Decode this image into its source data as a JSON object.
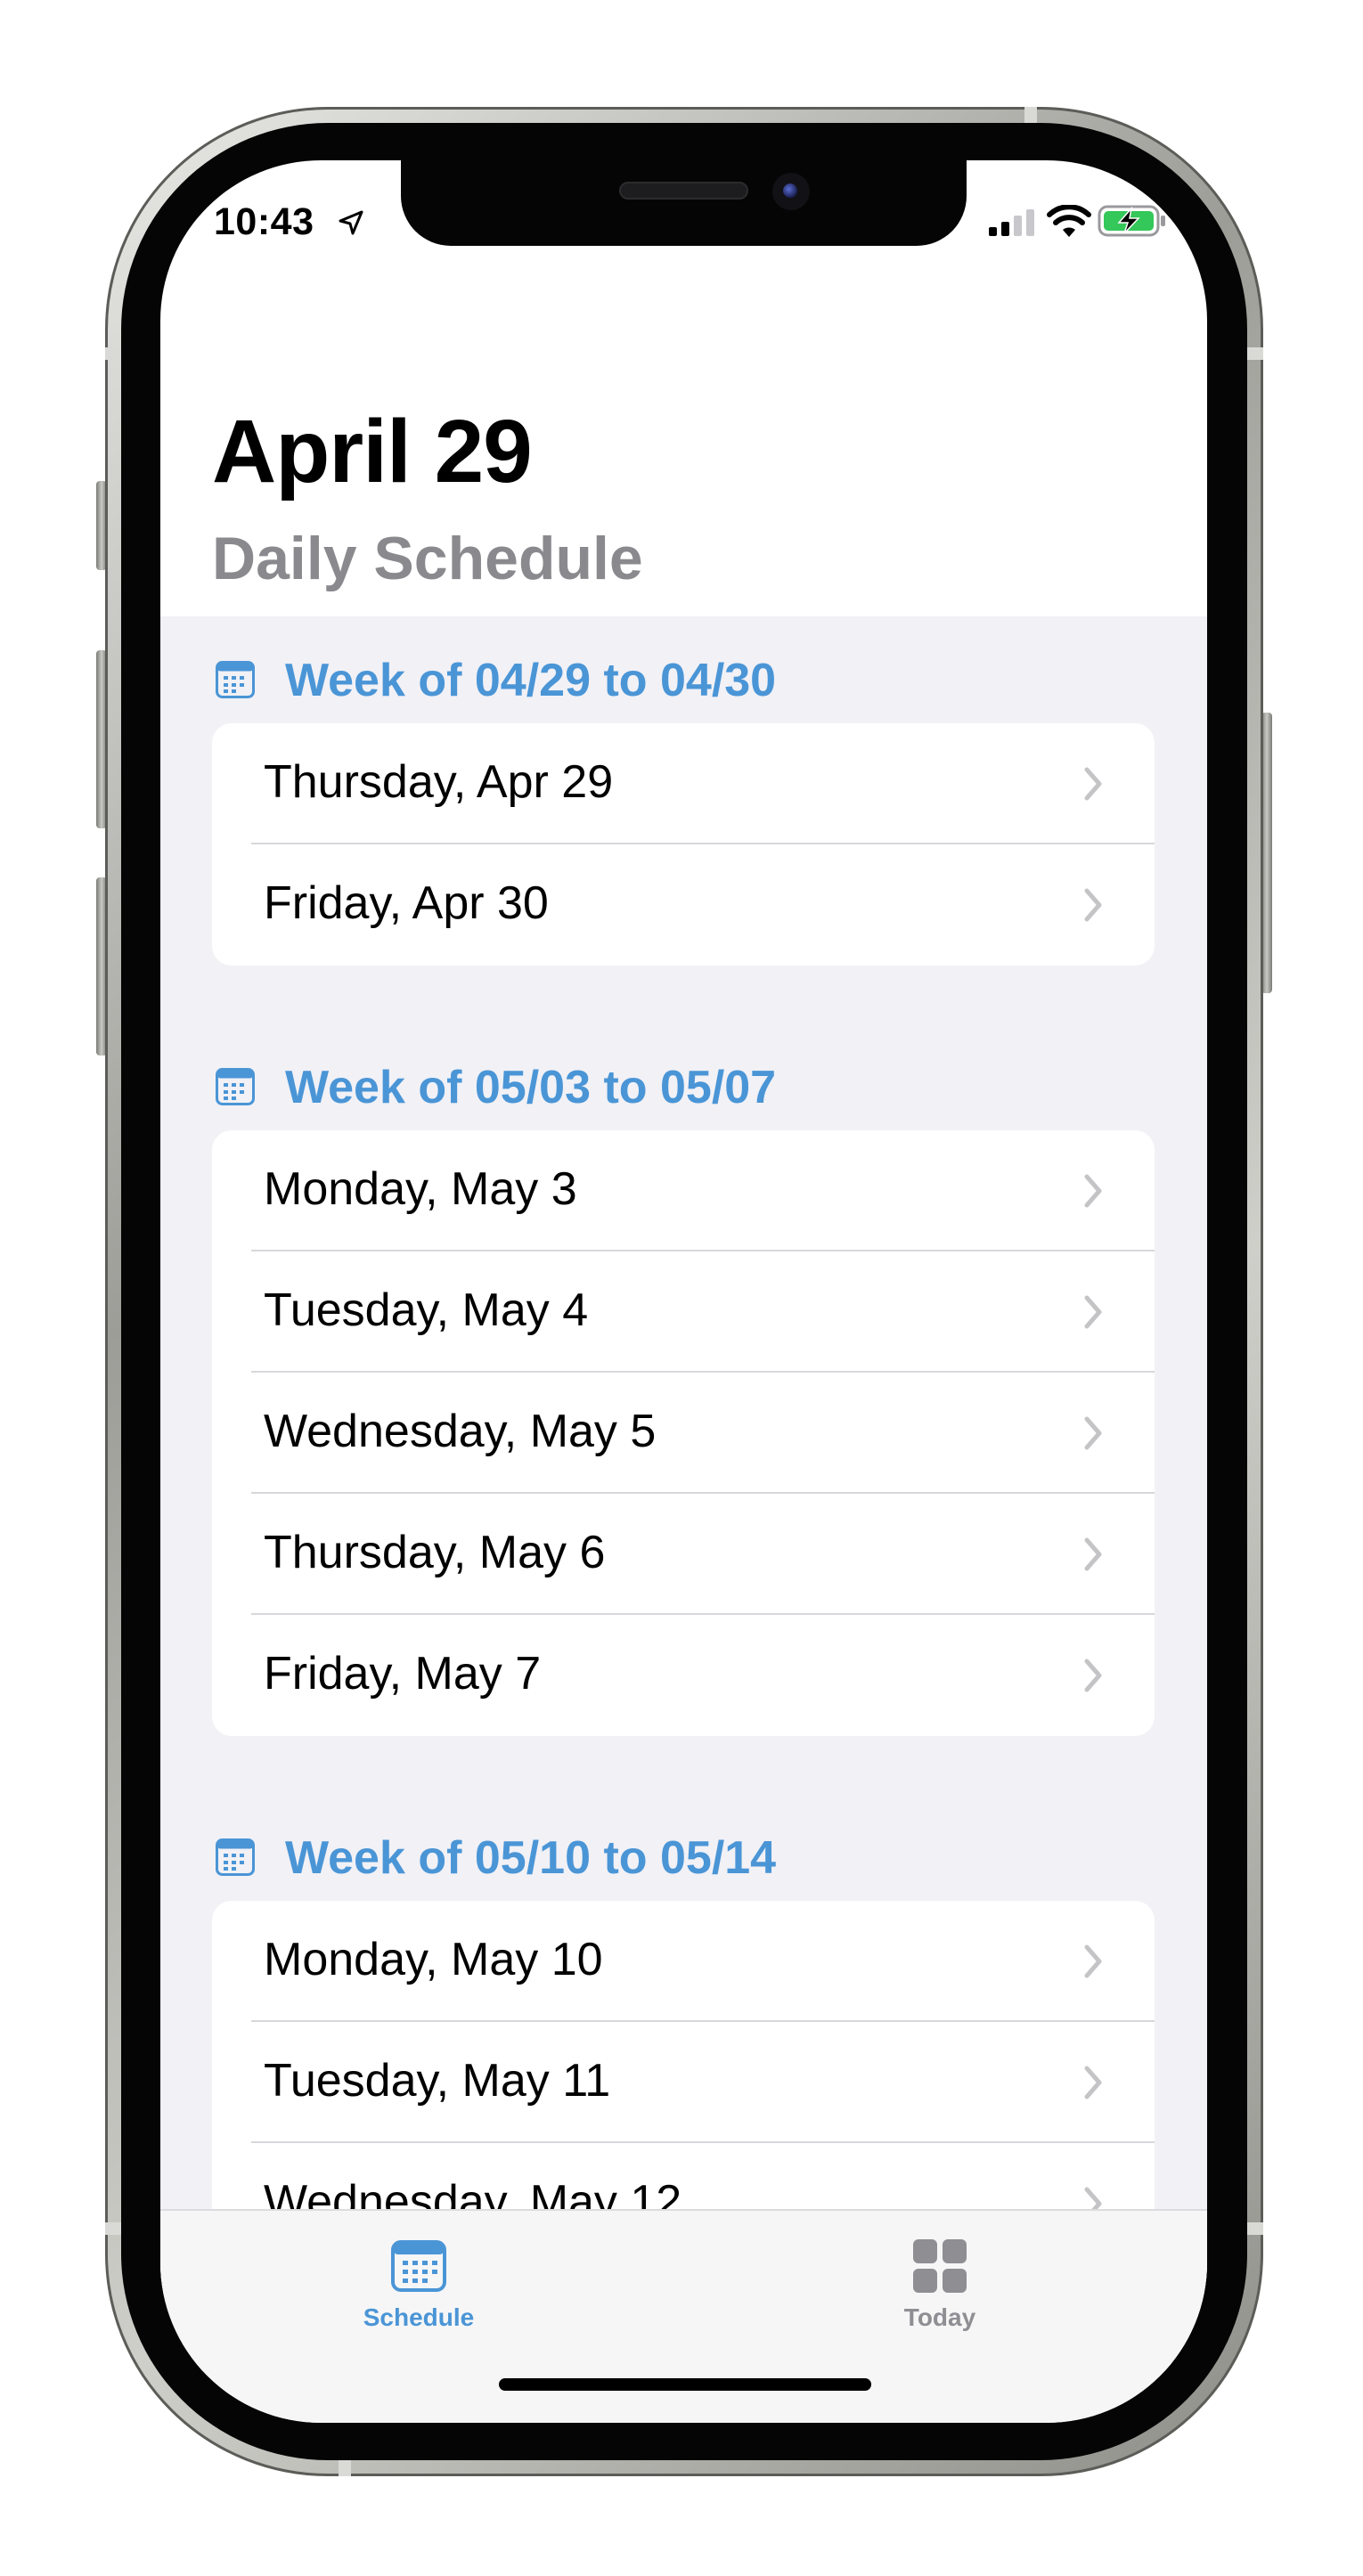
{
  "status_bar": {
    "time": "10:43"
  },
  "header": {
    "title": "April 29",
    "subtitle": "Daily Schedule"
  },
  "sections": [
    {
      "title": "Week of 04/29 to 04/30",
      "days": [
        "Thursday, Apr 29",
        "Friday, Apr 30"
      ]
    },
    {
      "title": "Week of 05/03 to 05/07",
      "days": [
        "Monday, May 3",
        "Tuesday, May 4",
        "Wednesday, May 5",
        "Thursday, May 6",
        "Friday, May 7"
      ]
    },
    {
      "title": "Week of 05/10 to 05/14",
      "days": [
        "Monday, May 10",
        "Tuesday, May 11",
        "Wednesday, May 12"
      ]
    }
  ],
  "tab_bar": {
    "schedule_label": "Schedule",
    "today_label": "Today",
    "selected": "Schedule"
  },
  "colors": {
    "accent": "#4a95d6",
    "background": "#f1f1f6",
    "inactive": "#8e8e93"
  }
}
